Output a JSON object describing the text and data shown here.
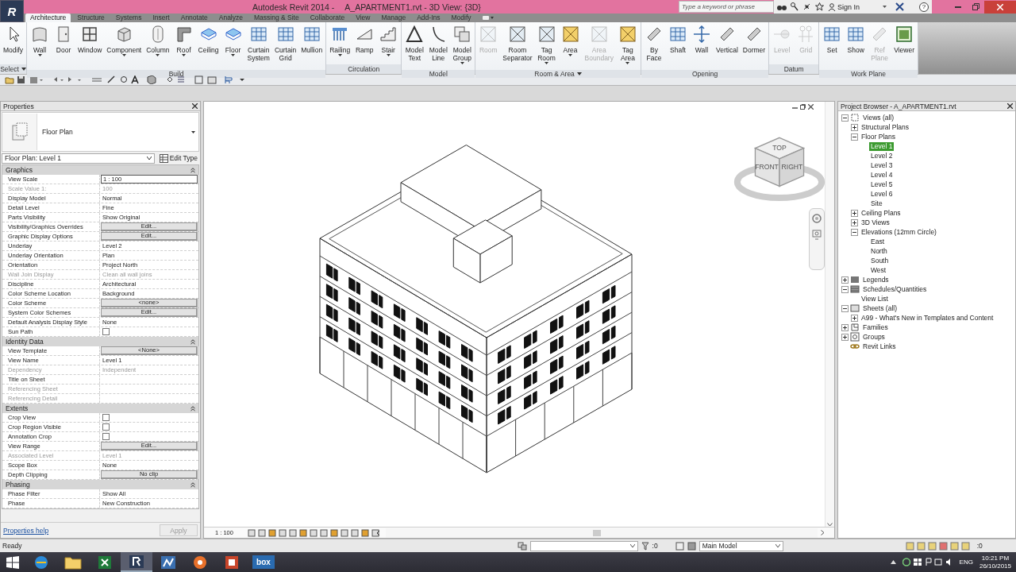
{
  "title_bar": {
    "app_logo": "R",
    "app_name": "Autodesk Revit 2014 -",
    "document": "A_APARTMENT1.rvt - 3D View: {3D}",
    "search": {
      "placeholder": "Type a keyword or phrase"
    },
    "sign_in": "Sign In",
    "help": "?"
  },
  "ribbon_tabs": [
    {
      "label": "Architecture",
      "selected": true
    },
    {
      "label": "Structure",
      "selected": false
    },
    {
      "label": "Systems",
      "selected": false
    },
    {
      "label": "Insert",
      "selected": false
    },
    {
      "label": "Annotate",
      "selected": false
    },
    {
      "label": "Analyze",
      "selected": false
    },
    {
      "label": "Massing & Site",
      "selected": false
    },
    {
      "label": "Collaborate",
      "selected": false
    },
    {
      "label": "View",
      "selected": false
    },
    {
      "label": "Manage",
      "selected": false
    },
    {
      "label": "Add-Ins",
      "selected": false
    },
    {
      "label": "Modify",
      "selected": false
    }
  ],
  "ribbon_panels": [
    {
      "title": "Select",
      "menu": true,
      "buttons": [
        {
          "label": "Modify",
          "kind": "pointer",
          "disabled": false,
          "dropdown": false
        }
      ]
    },
    {
      "title": "Build",
      "menu": false,
      "buttons": [
        {
          "label": "Wall",
          "kind": "wall",
          "disabled": false,
          "dropdown": true
        },
        {
          "label": "Door",
          "kind": "door",
          "disabled": false,
          "dropdown": false
        },
        {
          "label": "Window",
          "kind": "window",
          "disabled": false,
          "dropdown": false
        },
        {
          "label": "Component",
          "kind": "cube",
          "disabled": false,
          "dropdown": true
        },
        {
          "label": "Column",
          "kind": "column",
          "disabled": false,
          "dropdown": true
        },
        {
          "label": "Roof",
          "kind": "roof",
          "disabled": false,
          "dropdown": true
        },
        {
          "label": "Ceiling",
          "kind": "slab",
          "disabled": false,
          "dropdown": false
        },
        {
          "label": "Floor",
          "kind": "slab",
          "disabled": false,
          "dropdown": true
        },
        {
          "label": "Curtain\nSystem",
          "kind": "grid",
          "disabled": false,
          "dropdown": false
        },
        {
          "label": "Curtain\nGrid",
          "kind": "grid",
          "disabled": false,
          "dropdown": false
        },
        {
          "label": "Mullion",
          "kind": "grid",
          "disabled": false,
          "dropdown": false
        }
      ]
    },
    {
      "title": "Circulation",
      "menu": false,
      "buttons": [
        {
          "label": "Railing",
          "kind": "railing",
          "disabled": false,
          "dropdown": true
        },
        {
          "label": "Ramp",
          "kind": "ramp",
          "disabled": false,
          "dropdown": false
        },
        {
          "label": "Stair",
          "kind": "stairs",
          "disabled": false,
          "dropdown": true
        }
      ]
    },
    {
      "title": "Model",
      "menu": false,
      "buttons": [
        {
          "label": "Model\nText",
          "kind": "triangle",
          "disabled": false,
          "dropdown": false
        },
        {
          "label": "Model\nLine",
          "kind": "curve",
          "disabled": false,
          "dropdown": false
        },
        {
          "label": "Model\nGroup",
          "kind": "group",
          "disabled": false,
          "dropdown": true
        }
      ]
    },
    {
      "title": "Room & Area",
      "menu": true,
      "buttons": [
        {
          "label": "Room",
          "kind": "crossbox",
          "disabled": true,
          "dropdown": false
        },
        {
          "label": "Room\nSeparator",
          "kind": "crossbox",
          "disabled": false,
          "dropdown": false
        },
        {
          "label": "Tag\nRoom",
          "kind": "crossbox",
          "disabled": false,
          "dropdown": true
        },
        {
          "label": "Area",
          "kind": "areabox",
          "disabled": false,
          "dropdown": true
        },
        {
          "label": "Area\nBoundary",
          "kind": "crossbox",
          "disabled": true,
          "dropdown": false
        },
        {
          "label": "Tag\nArea",
          "kind": "areabox",
          "disabled": false,
          "dropdown": true
        }
      ]
    },
    {
      "title": "Opening",
      "menu": false,
      "buttons": [
        {
          "label": "By\nFace",
          "kind": "plane",
          "disabled": false,
          "dropdown": false
        },
        {
          "label": "Shaft",
          "kind": "grid",
          "disabled": false,
          "dropdown": false
        },
        {
          "label": "Wall",
          "kind": "arrows",
          "disabled": false,
          "dropdown": false
        },
        {
          "label": "Vertical",
          "kind": "plane",
          "disabled": false,
          "dropdown": false
        },
        {
          "label": "Dormer",
          "kind": "plane",
          "disabled": false,
          "dropdown": false
        }
      ]
    },
    {
      "title": "Datum",
      "menu": false,
      "buttons": [
        {
          "label": "Level",
          "kind": "level",
          "disabled": true,
          "dropdown": false
        },
        {
          "label": "Grid",
          "kind": "gridlines",
          "disabled": true,
          "dropdown": false
        }
      ]
    },
    {
      "title": "Work Plane",
      "menu": false,
      "buttons": [
        {
          "label": "Set",
          "kind": "grid",
          "disabled": false,
          "dropdown": false
        },
        {
          "label": "Show",
          "kind": "grid",
          "disabled": false,
          "dropdown": false
        },
        {
          "label": "Ref\nPlane",
          "kind": "plane",
          "disabled": true,
          "dropdown": false
        },
        {
          "label": "Viewer",
          "kind": "viewer",
          "disabled": false,
          "dropdown": false
        }
      ]
    }
  ],
  "properties": {
    "title": "Properties",
    "type_name": "Floor Plan",
    "instance": "Floor Plan: Level 1",
    "edit_type": "Edit Type",
    "groups": [
      {
        "name": "Graphics",
        "rows": [
          {
            "label": "View Scale",
            "kind": "field",
            "value": "1 : 100",
            "disabled": false
          },
          {
            "label": "Scale Value    1:",
            "kind": "text",
            "value": "100",
            "disabled": true
          },
          {
            "label": "Display Model",
            "kind": "text",
            "value": "Normal",
            "disabled": false
          },
          {
            "label": "Detail Level",
            "kind": "text",
            "value": "Fine",
            "disabled": false
          },
          {
            "label": "Parts Visibility",
            "kind": "text",
            "value": "Show Original",
            "disabled": false
          },
          {
            "label": "Visibility/Graphics Overrides",
            "kind": "button",
            "value": "Edit...",
            "disabled": false
          },
          {
            "label": "Graphic Display Options",
            "kind": "button",
            "value": "Edit...",
            "disabled": false
          },
          {
            "label": "Underlay",
            "kind": "text",
            "value": "Level 2",
            "disabled": false
          },
          {
            "label": "Underlay Orientation",
            "kind": "text",
            "value": "Plan",
            "disabled": false
          },
          {
            "label": "Orientation",
            "kind": "text",
            "value": "Project North",
            "disabled": false
          },
          {
            "label": "Wall Join Display",
            "kind": "text",
            "value": "Clean all wall joins",
            "disabled": true
          },
          {
            "label": "Discipline",
            "kind": "text",
            "value": "Architectural",
            "disabled": false
          },
          {
            "label": "Color Scheme Location",
            "kind": "text",
            "value": "Background",
            "disabled": false
          },
          {
            "label": "Color Scheme",
            "kind": "button",
            "value": "<none>",
            "disabled": false
          },
          {
            "label": "System Color Schemes",
            "kind": "button",
            "value": "Edit...",
            "disabled": false
          },
          {
            "label": "Default Analysis Display Style",
            "kind": "text",
            "value": "None",
            "disabled": false
          },
          {
            "label": "Sun Path",
            "kind": "checkbox",
            "checked": false,
            "disabled": false
          }
        ]
      },
      {
        "name": "Identity Data",
        "rows": [
          {
            "label": "View Template",
            "kind": "button",
            "value": "<None>",
            "disabled": false
          },
          {
            "label": "View Name",
            "kind": "text",
            "value": "Level 1",
            "disabled": false
          },
          {
            "label": "Dependency",
            "kind": "text",
            "value": "Independent",
            "disabled": true
          },
          {
            "label": "Title on Sheet",
            "kind": "text",
            "disabled": false
          },
          {
            "label": "Referencing Sheet",
            "kind": "text",
            "disabled": true
          },
          {
            "label": "Referencing Detail",
            "kind": "text",
            "disabled": true
          }
        ]
      },
      {
        "name": "Extents",
        "rows": [
          {
            "label": "Crop View",
            "kind": "checkbox",
            "checked": false,
            "disabled": false
          },
          {
            "label": "Crop Region Visible",
            "kind": "checkbox",
            "checked": false,
            "disabled": false
          },
          {
            "label": "Annotation Crop",
            "kind": "checkbox",
            "checked": false,
            "disabled": false
          },
          {
            "label": "View Range",
            "kind": "button",
            "value": "Edit...",
            "disabled": false
          },
          {
            "label": "Associated Level",
            "kind": "text",
            "value": "Level 1",
            "disabled": true
          },
          {
            "label": "Scope Box",
            "kind": "text",
            "value": "None",
            "disabled": false
          },
          {
            "label": "Depth Clipping",
            "kind": "button",
            "value": "No clip",
            "disabled": false
          }
        ]
      },
      {
        "name": "Phasing",
        "rows": [
          {
            "label": "Phase Filter",
            "kind": "text",
            "value": "Show All",
            "disabled": false
          },
          {
            "label": "Phase",
            "kind": "text",
            "value": "New Construction",
            "disabled": false
          }
        ]
      }
    ],
    "help": "Properties help",
    "apply": {
      "label": "Apply",
      "disabled": true
    }
  },
  "view": {
    "scale": "1 : 100",
    "cube_faces": [
      "TOP",
      "FRONT",
      "RIGHT"
    ]
  },
  "browser": {
    "title": "Project Browser - A_APARTMENT1.rvt",
    "tree": [
      {
        "label": "Views (all)",
        "kind": "views",
        "expanded": true,
        "selected": false,
        "children": [
          {
            "label": "Structural Plans",
            "expanded": false,
            "selected": false
          },
          {
            "label": "Floor Plans",
            "expanded": true,
            "selected": false,
            "children": [
              {
                "label": "Level 1",
                "selected": true
              },
              {
                "label": "Level 2",
                "selected": false
              },
              {
                "label": "Level 3",
                "selected": false
              },
              {
                "label": "Level 4",
                "selected": false
              },
              {
                "label": "Level 5",
                "selected": false
              },
              {
                "label": "Level 6",
                "selected": false
              },
              {
                "label": "Site",
                "selected": false
              }
            ]
          },
          {
            "label": "Ceiling Plans",
            "expanded": false,
            "selected": false
          },
          {
            "label": "3D Views",
            "expanded": false,
            "selected": false
          },
          {
            "label": "Elevations (12mm Circle)",
            "expanded": true,
            "selected": false,
            "children": [
              {
                "label": "East",
                "selected": false
              },
              {
                "label": "North",
                "selected": false
              },
              {
                "label": "South",
                "selected": false
              },
              {
                "label": "West",
                "selected": false
              }
            ]
          }
        ]
      },
      {
        "label": "Legends",
        "kind": "legends",
        "expanded": false,
        "selected": false
      },
      {
        "label": "Schedules/Quantities",
        "kind": "schedules",
        "expanded": true,
        "selected": false,
        "children": [
          {
            "label": "View List",
            "selected": false
          }
        ]
      },
      {
        "label": "Sheets (all)",
        "kind": "sheets",
        "expanded": true,
        "selected": false,
        "children": [
          {
            "label": "A99 - What's New in Templates and Content",
            "expanded": false,
            "selected": false
          }
        ]
      },
      {
        "label": "Families",
        "kind": "families",
        "expanded": false,
        "selected": false
      },
      {
        "label": "Groups",
        "kind": "groups",
        "expanded": false,
        "selected": false
      },
      {
        "label": "Revit Links",
        "kind": "links",
        "selected": false
      }
    ]
  },
  "status_bar": {
    "text": "Ready",
    "workset_count": ":0",
    "model": "Main Model",
    "filter_count": ":0"
  },
  "taskbar": {
    "apps": [
      {
        "kind": "globe",
        "selected": false
      },
      {
        "kind": "folder",
        "selected": false
      },
      {
        "kind": "sheet",
        "selected": false
      },
      {
        "kind": "cad",
        "selected": true
      },
      {
        "kind": "chart",
        "selected": false
      },
      {
        "kind": "disc",
        "selected": false
      },
      {
        "kind": "slides",
        "selected": false
      },
      {
        "kind": "box",
        "label": "box",
        "selected": false
      }
    ],
    "language": "ENG",
    "time": "10:21 PM",
    "date": "26/10/2015"
  }
}
